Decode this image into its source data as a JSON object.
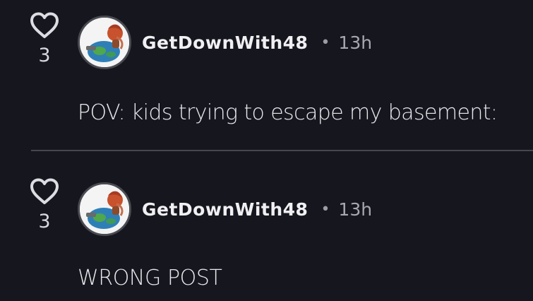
{
  "comments": [
    {
      "likes": "3",
      "username": "GetDownWith48",
      "separator": "•",
      "time": "13h",
      "text": "POV: kids trying to escape my basement:"
    },
    {
      "likes": "3",
      "username": "GetDownWith48",
      "separator": "•",
      "time": "13h",
      "text": "WRONG POST"
    }
  ],
  "icons": {
    "like": "heart-icon",
    "avatar": "user-avatar"
  },
  "colors": {
    "background": "#16161f",
    "text": "#e6e6ea",
    "muted": "#a8a8b2",
    "divider": "#47474f"
  }
}
